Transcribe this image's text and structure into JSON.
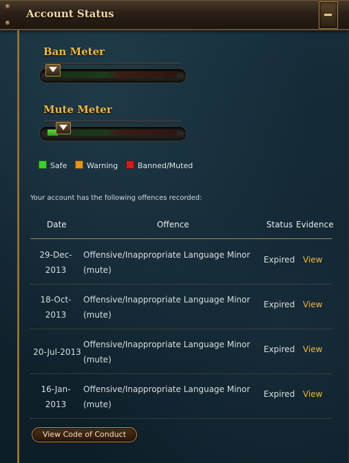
{
  "header": {
    "title": "Account Status"
  },
  "meters": {
    "ban": {
      "title": "Ban Meter",
      "level": 0.0
    },
    "mute": {
      "title": "Mute Meter",
      "level": 0.08
    }
  },
  "legend": {
    "items": [
      {
        "label": "Safe",
        "color": "#3bd12a"
      },
      {
        "label": "Warning",
        "color": "#e8931c"
      },
      {
        "label": "Banned/Muted",
        "color": "#d41c1c"
      }
    ]
  },
  "offences": {
    "intro": "Your account has the following offences recorded:",
    "columns": {
      "date": "Date",
      "offence": "Offence",
      "status": "Status",
      "evidence": "Evidence"
    },
    "rows": [
      {
        "date_day": "29-Dec-",
        "date_year": "2013",
        "offence_1": "Offensive/Inappropriate Language Minor",
        "offence_2": "(mute)",
        "status": "Expired",
        "evidence": "View"
      },
      {
        "date_day": "18-Oct-",
        "date_year": "2013",
        "offence_1": "Offensive/Inappropriate Language Minor",
        "offence_2": "(mute)",
        "status": "Expired",
        "evidence": "View"
      },
      {
        "date_day": "20-Jul-2013",
        "date_year": "",
        "offence_1": "Offensive/Inappropriate Language Minor",
        "offence_2": "(mute)",
        "status": "Expired",
        "evidence": "View"
      },
      {
        "date_day": "16-Jan-",
        "date_year": "2013",
        "offence_1": "Offensive/Inappropriate Language Minor",
        "offence_2": "(mute)",
        "status": "Expired",
        "evidence": "View"
      }
    ]
  },
  "footer": {
    "code_of_conduct_label": "View Code of Conduct"
  },
  "icons": {
    "collapse": "minus-icon"
  }
}
